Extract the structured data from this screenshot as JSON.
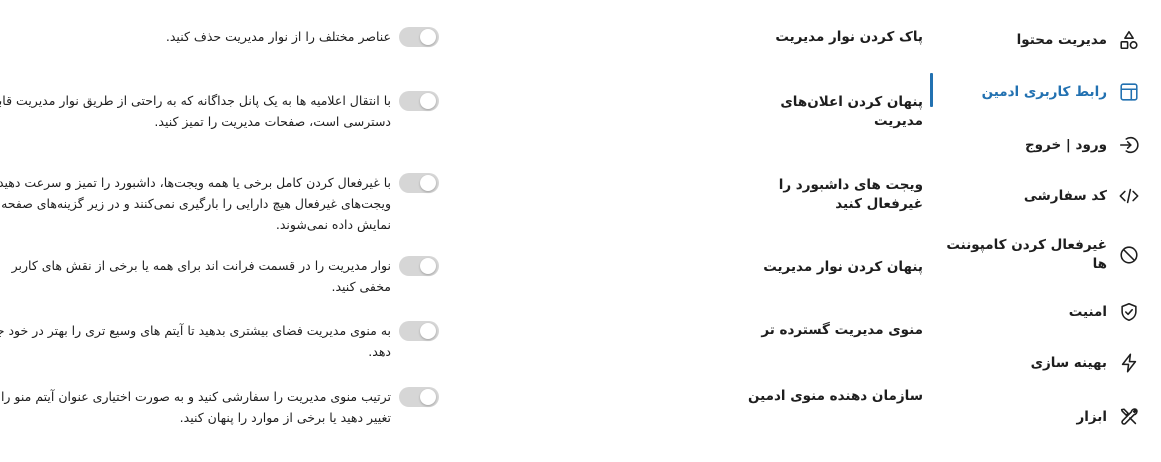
{
  "sidebar": {
    "active_color": "#2271b1",
    "items": [
      {
        "label": "مدیریت محتوا",
        "icon": "shapes-icon",
        "active": false
      },
      {
        "label": "رابط کاربری ادمین",
        "icon": "layout-icon",
        "active": true
      },
      {
        "label": "ورود | خروج",
        "icon": "login-icon",
        "active": false
      },
      {
        "label": "کد سفارشی",
        "icon": "code-icon",
        "active": false
      },
      {
        "label": "غیرفعال کردن کامپوننت ها",
        "icon": "disable-icon",
        "active": false
      },
      {
        "label": "امنیت",
        "icon": "shield-check-icon",
        "active": false
      },
      {
        "label": "بهینه سازی",
        "icon": "lightning-icon",
        "active": false
      },
      {
        "label": "ابزار",
        "icon": "tools-icon",
        "active": false
      }
    ]
  },
  "settings": [
    {
      "title": "پاک کردن نوار مدیریت",
      "description": "عناصر مختلف را از نوار مدیریت حذف کنید.",
      "enabled": false
    },
    {
      "title": "پنهان کردن اعلان‌های مدیریت",
      "description": "با انتقال اعلامیه ها به یک پانل جداگانه که به راحتی از طریق نوار مدیریت قابل دسترسی است، صفحات مدیریت را تمیز کنید.",
      "enabled": false
    },
    {
      "title": "ویجت های داشبورد را غیرفعال کنید",
      "description": "با غیرفعال کردن کامل برخی یا همه ویجت‌ها، داشبورد را تمیز و سرعت دهید. ویجت‌های غیرفعال هیچ دارایی را بارگیری نمی‌کنند و در زیر گزینه‌های صفحه نمایش داده نمی‌شوند.",
      "enabled": false
    },
    {
      "title": "پنهان کردن نوار مدیریت",
      "description": "نوار مدیریت را در قسمت فرانت اند برای همه یا برخی از نقش های کاربر مخفی کنید.",
      "enabled": false
    },
    {
      "title": "منوی مدیریت گسترده تر",
      "description": "به منوی مدیریت فضای بیشتری بدهید تا آیتم های وسیع تری را بهتر در خود جای دهد.",
      "enabled": false
    },
    {
      "title": "سازمان دهنده منوی ادمین",
      "description": "ترتیب منوی مدیریت را سفارشی کنید و به صورت اختیاری عنوان آیتم منو را تغییر دهید یا برخی از موارد را پنهان کنید.",
      "enabled": false
    }
  ]
}
